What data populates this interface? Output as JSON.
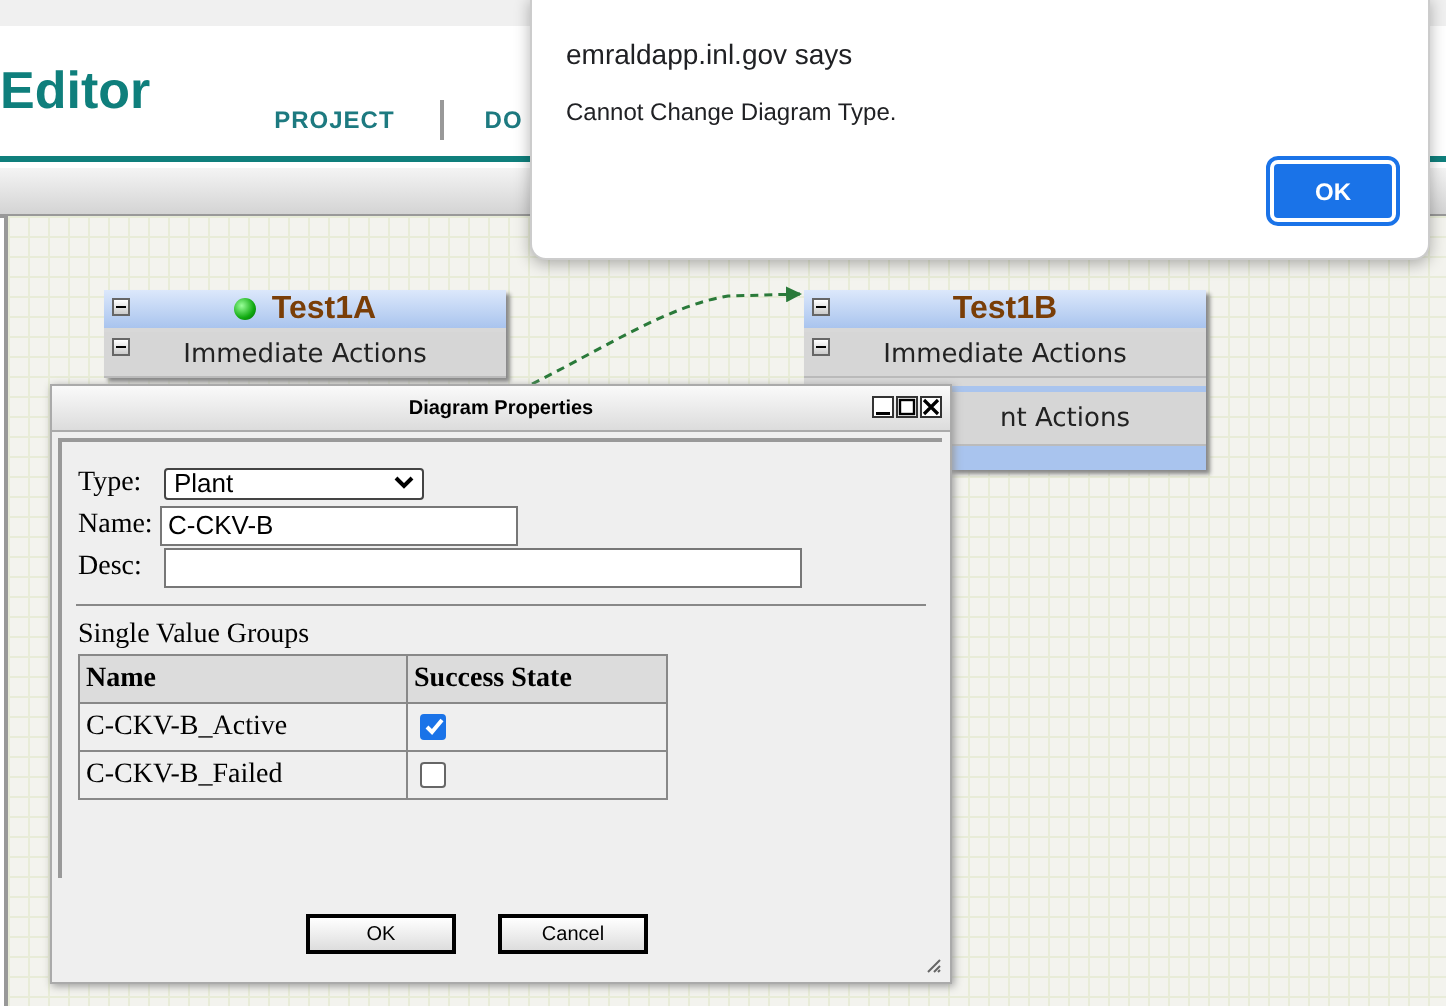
{
  "header": {
    "title": "Editor",
    "nav": [
      {
        "label": "PROJECT"
      },
      {
        "label": "DO"
      }
    ]
  },
  "nodes": [
    {
      "title": "Test1A",
      "indicator": true,
      "rows": [
        "Immediate Actions"
      ]
    },
    {
      "title": "Test1B",
      "indicator": false,
      "rows": [
        "Immediate Actions",
        "nt Actions"
      ]
    }
  ],
  "dialog": {
    "title": "Diagram Properties",
    "type": {
      "label": "Type:",
      "value": "Plant"
    },
    "name": {
      "label": "Name:",
      "value": "C-CKV-B"
    },
    "desc": {
      "label": "Desc:"
    },
    "group_title": "Single Value Groups",
    "table": {
      "columns": [
        "Name",
        "Success State"
      ],
      "rows": [
        {
          "name": "C-CKV-B_Active",
          "checked": true
        },
        {
          "name": "C-CKV-B_Failed",
          "checked": false
        }
      ]
    },
    "buttons": [
      "OK",
      "Cancel"
    ]
  },
  "alert": {
    "origin": "emraldapp.inl.gov says",
    "message": "Cannot Change Diagram Type.",
    "button": "OK"
  }
}
